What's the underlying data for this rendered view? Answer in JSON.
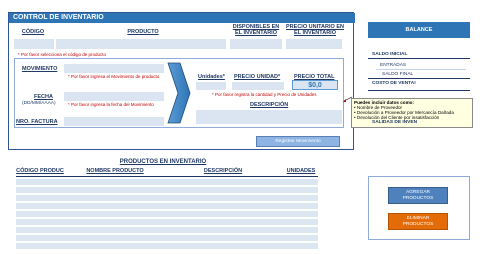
{
  "control": {
    "title": "CONTROL DE INVENTARIO",
    "headers": {
      "codigo": "CÓDIGO",
      "producto": "PRODUCTO",
      "disponibles": "DISPONIBLES EN EL INVENTARIO",
      "precio_unitario": "PRECIO UNITARIO EN EL INVENTARIO"
    },
    "hint_codigo": "* Por favor selecciona el código de producto",
    "movimiento_label": "MOVIMIENTO",
    "hint_movimiento": "* Por favor ingresa el Movimiento de producto",
    "fecha_label": "FECHA",
    "fecha_format": "(DD/MM/AAAA)",
    "hint_fecha": "* Por favor ingresa la fecha del Movimiento",
    "nro_factura_label": "NRO. FACTURA",
    "unidades_label": "Unidades*",
    "precio_unidad_label": "PRECIO UNIDAD*",
    "precio_total_label": "PRECIO TOTAL",
    "precio_total_value": "$0,0",
    "hint_cantidad": "* Por favor registra la cantidad y Precio de Unidades",
    "descripcion_label": "DESCRIPCIÓN",
    "register_button": "Registrar Movimiento"
  },
  "note": {
    "title": "Puedes incluir datos como:",
    "lines": [
      "• Nombre de Proveedor",
      "• Devolución a Proveedor por Mercancía Dañada",
      "• Devolución del Cliente por insatisfacción"
    ]
  },
  "balance": {
    "header": "BALANCE",
    "saldo_inicial": "SALDO INICIAL",
    "entradas": "ENTRADAS",
    "saldo_final": "SALDO FINAL",
    "costo_venta": "COSTO DE VENTA!",
    "salidas": "SALIDAS DE INVEN"
  },
  "table": {
    "title": "PRODUCTOS EN INVENTARIO",
    "columns": [
      "CÓDIGO PRODUC",
      "NOMBRE PRODUCTO",
      "DESCRIPCIÓN",
      "UNIDADES"
    ]
  },
  "actions": {
    "add_line1": "AGREGAR",
    "add_line2": "PRODUCTOS",
    "delete_line1": "ELIMINAR",
    "delete_line2": "PRODUCTOS"
  },
  "colors": {
    "title_bar": "#2e75b6",
    "field_fill": "#dbe5f1",
    "add_button": "#4f81bd",
    "delete_button": "#e36c09",
    "hint_text": "#c00000"
  }
}
